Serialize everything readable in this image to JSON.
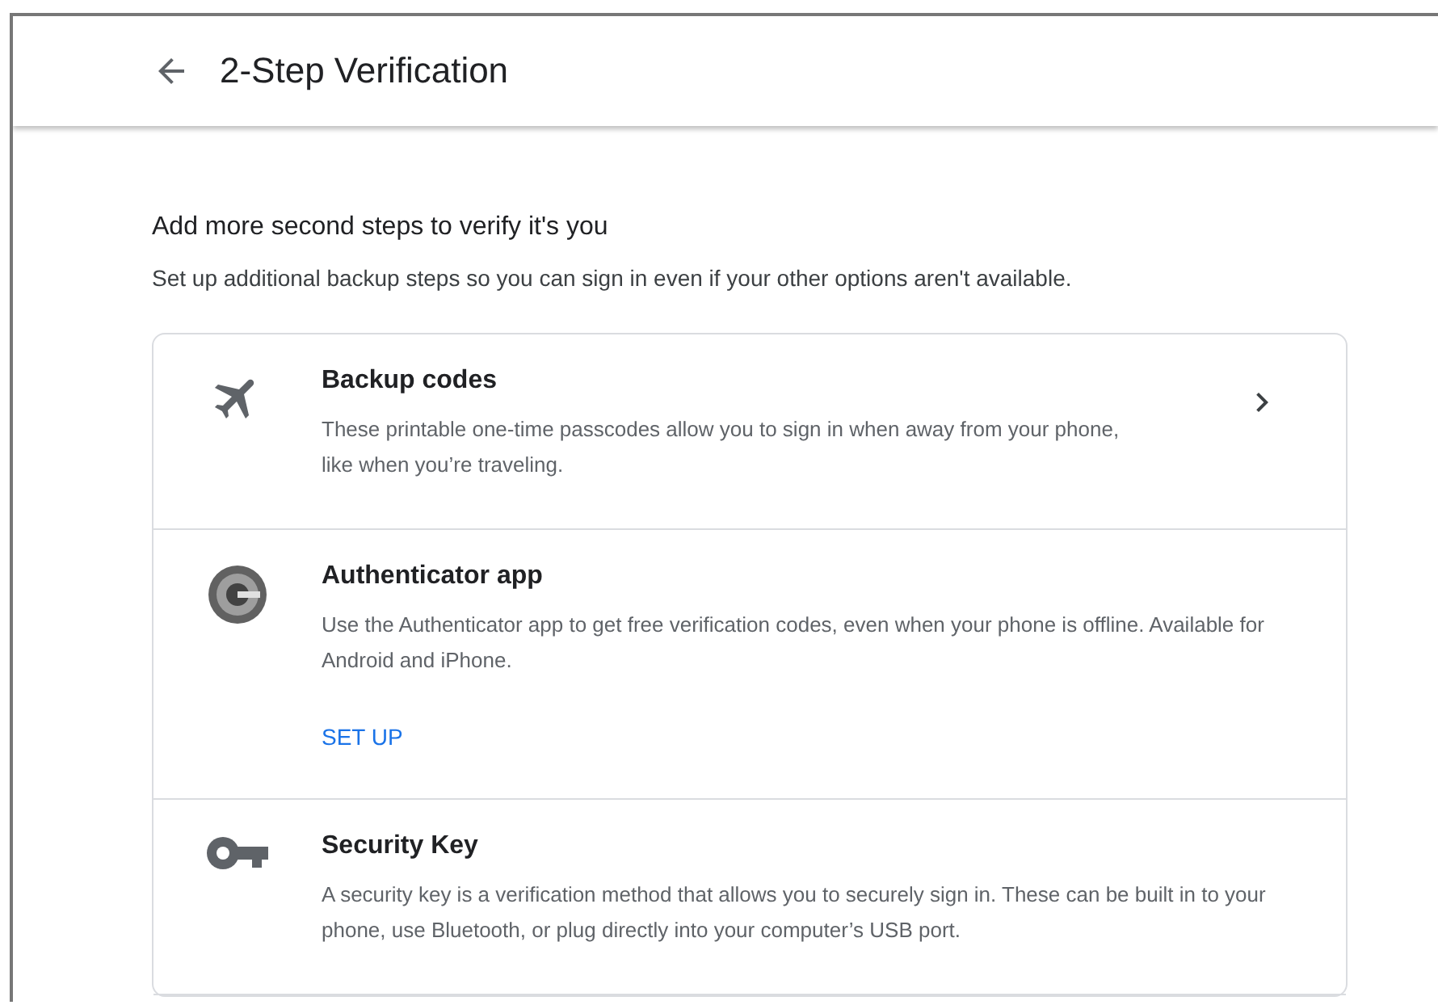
{
  "header": {
    "title": "2-Step Verification"
  },
  "section": {
    "heading": "Add more second steps to verify it's you",
    "description": "Set up additional backup steps so you can sign in even if your other options aren't available."
  },
  "options": [
    {
      "kind": "plane",
      "title": "Backup codes",
      "description": "These printable one-time passcodes allow you to sign in when away from your phone, like when you’re traveling.",
      "chevron": true
    },
    {
      "kind": "authenticator",
      "title": "Authenticator app",
      "description": "Use the Authenticator app to get free verification codes, even when your phone is offline. Available for Android and iPhone.",
      "action": "SET UP"
    },
    {
      "kind": "key",
      "title": "Security Key",
      "description": "A security key is a verification method that allows you to securely sign in. These can be built in to your phone, use Bluetooth, or plug directly into your computer’s USB port."
    }
  ]
}
